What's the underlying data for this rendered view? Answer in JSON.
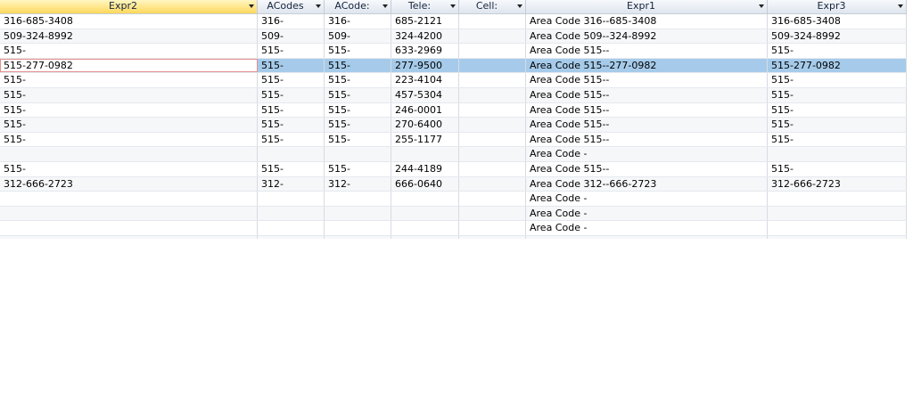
{
  "columns": [
    {
      "label": "Expr2"
    },
    {
      "label": "ACodes"
    },
    {
      "label": "ACode:"
    },
    {
      "label": "Tele:"
    },
    {
      "label": "Cell:"
    },
    {
      "label": "Expr1"
    },
    {
      "label": "Expr3"
    }
  ],
  "rows": [
    [
      "316-685-3408",
      "316-",
      "316-",
      "685-2121",
      "",
      "Area Code 316--685-3408",
      "316-685-3408"
    ],
    [
      "509-324-8992",
      "509-",
      "509-",
      "324-4200",
      "",
      "Area Code 509--324-8992",
      "509-324-8992"
    ],
    [
      "515-",
      "515-",
      "515-",
      "633-2969",
      "",
      "Area Code 515--",
      "515-"
    ],
    [
      "515-277-0982",
      "515-",
      "515-",
      "277-9500",
      "",
      "Area Code 515--277-0982",
      "515-277-0982"
    ],
    [
      "515-",
      "515-",
      "515-",
      "223-4104",
      "",
      "Area Code 515--",
      "515-"
    ],
    [
      "515-",
      "515-",
      "515-",
      "457-5304",
      "",
      "Area Code 515--",
      "515-"
    ],
    [
      "515-",
      "515-",
      "515-",
      "246-0001",
      "",
      "Area Code 515--",
      "515-"
    ],
    [
      "515-",
      "515-",
      "515-",
      "270-6400",
      "",
      "Area Code 515--",
      "515-"
    ],
    [
      "515-",
      "515-",
      "515-",
      "255-1177",
      "",
      "Area Code 515--",
      "515-"
    ],
    [
      "",
      "",
      "",
      "",
      "",
      "Area Code -",
      ""
    ],
    [
      "515-",
      "515-",
      "515-",
      "244-4189",
      "",
      "Area Code 515--",
      "515-"
    ],
    [
      "312-666-2723",
      "312-",
      "312-",
      "666-0640",
      "",
      "Area Code 312--666-2723",
      "312-666-2723"
    ],
    [
      "",
      "",
      "",
      "",
      "",
      "Area Code -",
      ""
    ],
    [
      "",
      "",
      "",
      "",
      "",
      "Area Code -",
      ""
    ],
    [
      "",
      "",
      "",
      "",
      "",
      "Area Code -",
      ""
    ]
  ],
  "selected_row": 3,
  "active_column": 0,
  "colors": {
    "active_header": "#ffd85c",
    "selected_row": "#a6cbea",
    "focus_border": "#e58f8f"
  }
}
